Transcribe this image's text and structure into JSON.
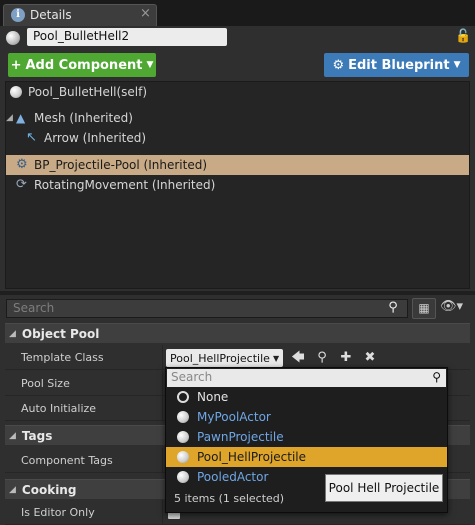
{
  "tab": {
    "icon_glyph": "i",
    "title": "Details",
    "close": "×"
  },
  "actor": {
    "name": "Pool_BulletHell2"
  },
  "toolbar": {
    "add_component": "Add Component",
    "edit_blueprint": "Edit Blueprint",
    "add_color": "#4ea832",
    "blueprint_color": "#3d7ab8"
  },
  "tree": {
    "items": [
      {
        "label": "Pool_BulletHell(self)",
        "icon": "sphere-icon"
      },
      {
        "label": "Mesh (Inherited)",
        "icon": "mesh-icon"
      },
      {
        "label": "Arrow (Inherited)",
        "icon": "arrow-icon"
      },
      {
        "label": "BP_Projectile-Pool (Inherited)",
        "icon": "gear-icon",
        "selected": true
      },
      {
        "label": "RotatingMovement (Inherited)",
        "icon": "rotating-icon"
      }
    ]
  },
  "details_search": {
    "placeholder": "Search"
  },
  "categories": {
    "object_pool": {
      "title": "Object Pool",
      "template_class_label": "Template Class",
      "template_class_value": "Pool_HellProjectile",
      "pool_size_label": "Pool Size",
      "auto_initialize_label": "Auto Initialize"
    },
    "tags": {
      "title": "Tags",
      "component_tags_label": "Component Tags"
    },
    "cooking": {
      "title": "Cooking",
      "is_editor_only_label": "Is Editor Only"
    }
  },
  "dropdown": {
    "search_placeholder": "Search",
    "items": [
      {
        "label": "None",
        "kind": "none"
      },
      {
        "label": "MyPoolActor",
        "kind": "class"
      },
      {
        "label": "PawnProjectile",
        "kind": "class"
      },
      {
        "label": "Pool_HellProjectile",
        "kind": "class",
        "highlighted": true
      },
      {
        "label": "PooledActor",
        "kind": "class"
      }
    ],
    "footer": "5 items (1 selected)",
    "highlight_color": "#dfa52a"
  },
  "tooltip": {
    "text": "Pool Hell Projectile"
  }
}
